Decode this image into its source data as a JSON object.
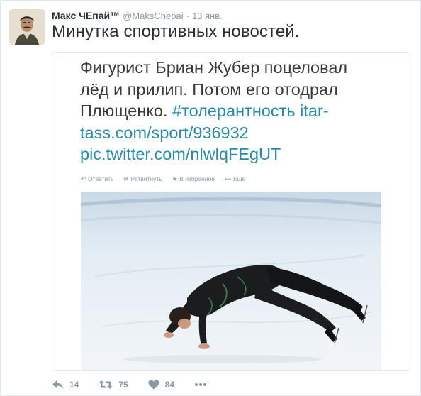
{
  "author": {
    "full_name": "Макс ЧЕпай™",
    "username": "@MaksChepai",
    "separator": "·",
    "timestamp": "13 янв."
  },
  "tweet": {
    "text": "Минутка спортивных новостей."
  },
  "embedded": {
    "lines": [
      "Фигурист Бриан Жубер поцеловал",
      "лёд и прилип. Потом его отодрал"
    ],
    "line3_plain": "Плющенко. ",
    "line3_hashtag": "#толерантность",
    "line3_link": " itar-",
    "line4": "tass.com/sport/936932",
    "line5": "pic.twitter.com/nlwlqFEgUT",
    "actions": {
      "reply": "Ответить",
      "retweet": "Ретвитнуть",
      "favorite": "В избранное",
      "more": "Ещё"
    }
  },
  "stats": {
    "replies": "14",
    "retweets": "75",
    "likes": "84"
  },
  "colors": {
    "link": "#2a8ba8",
    "muted": "#8899a6",
    "text": "#292f33"
  },
  "icons": {
    "reply": "reply-icon",
    "retweet": "retweet-icon",
    "like": "heart-icon",
    "more": "more-dots-icon"
  }
}
